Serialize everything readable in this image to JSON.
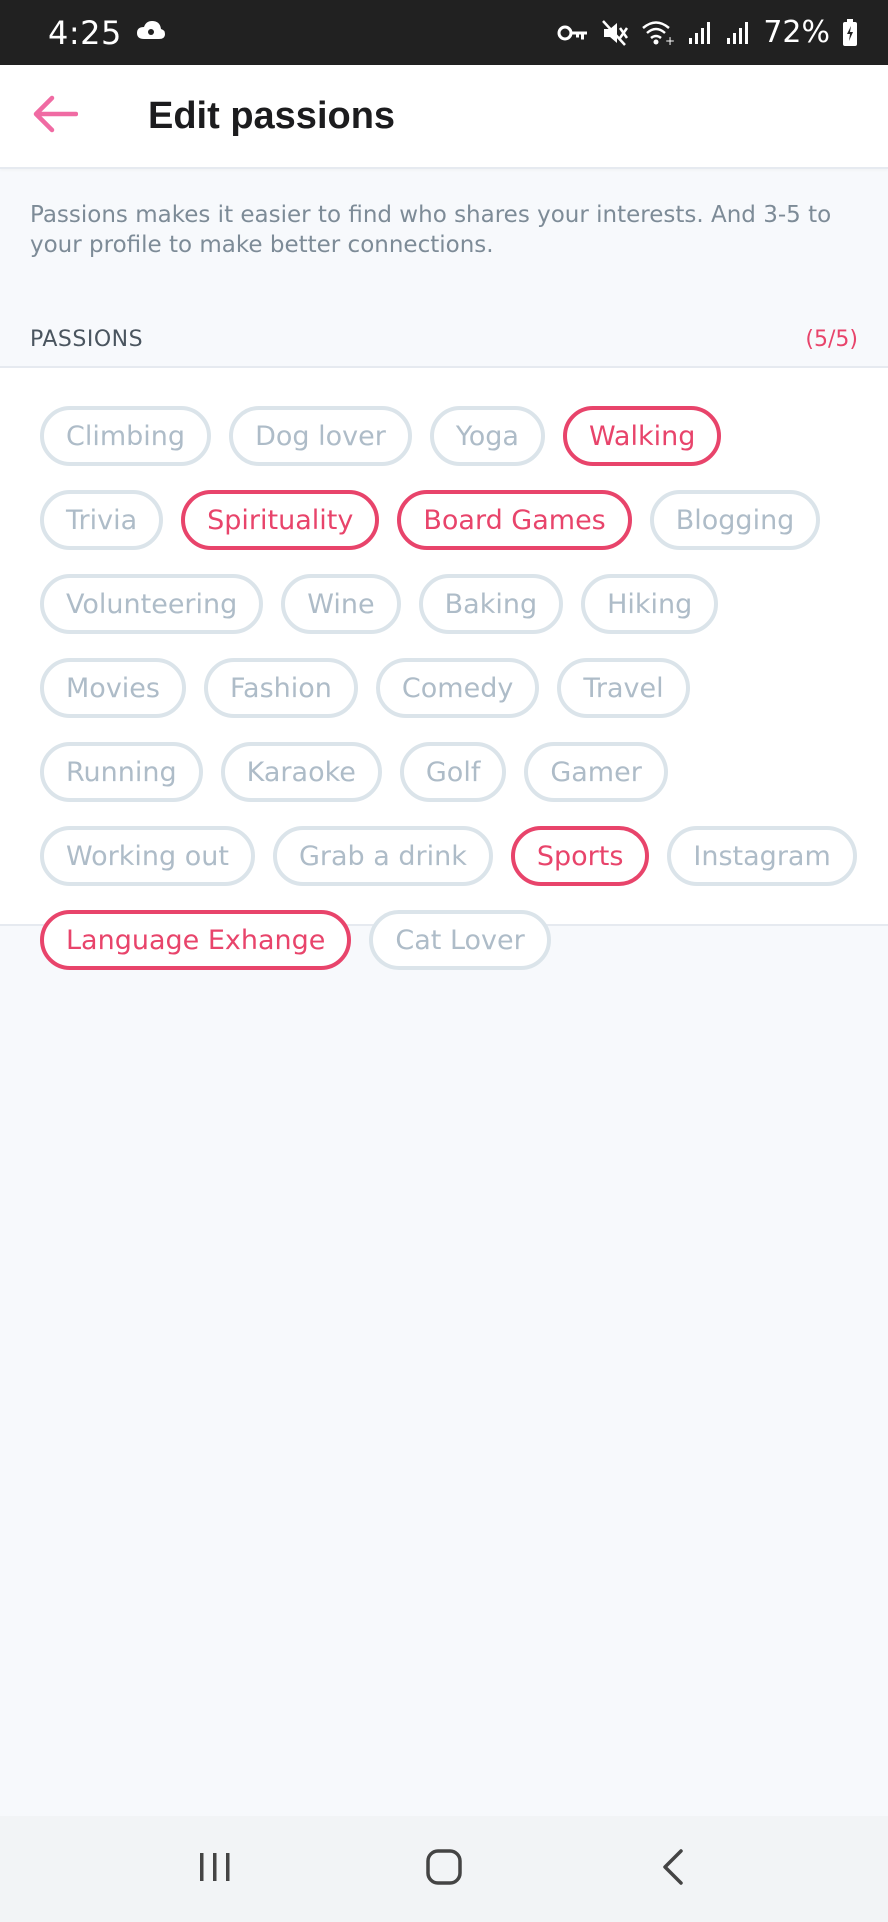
{
  "status_bar": {
    "time": "4:25",
    "battery": "72%"
  },
  "app_bar": {
    "title": "Edit passions",
    "back_icon": "arrow-left-icon",
    "accent_color": "#e8446b"
  },
  "description": "Passions makes it easier to find who shares your interests. And 3-5 to your profile to make better connections.",
  "section": {
    "label": "PASSIONS",
    "count": "(5/5)"
  },
  "passions": [
    {
      "label": "Climbing",
      "selected": false
    },
    {
      "label": "Dog lover",
      "selected": false
    },
    {
      "label": "Yoga",
      "selected": false
    },
    {
      "label": "Walking",
      "selected": true
    },
    {
      "label": "Trivia",
      "selected": false
    },
    {
      "label": "Spirituality",
      "selected": true
    },
    {
      "label": "Board Games",
      "selected": true
    },
    {
      "label": "Blogging",
      "selected": false
    },
    {
      "label": "Volunteering",
      "selected": false
    },
    {
      "label": "Wine",
      "selected": false
    },
    {
      "label": "Baking",
      "selected": false
    },
    {
      "label": "Hiking",
      "selected": false
    },
    {
      "label": "Movies",
      "selected": false
    },
    {
      "label": "Fashion",
      "selected": false
    },
    {
      "label": "Comedy",
      "selected": false
    },
    {
      "label": "Travel",
      "selected": false
    },
    {
      "label": "Running",
      "selected": false
    },
    {
      "label": "Karaoke",
      "selected": false
    },
    {
      "label": "Golf",
      "selected": false
    },
    {
      "label": "Gamer",
      "selected": false
    },
    {
      "label": "Working out",
      "selected": false
    },
    {
      "label": "Grab a drink",
      "selected": false
    },
    {
      "label": "Sports",
      "selected": true
    },
    {
      "label": "Instagram",
      "selected": false
    },
    {
      "label": "Language Exhange",
      "selected": true
    },
    {
      "label": "Cat Lover",
      "selected": false
    }
  ],
  "nav_bar": {
    "recents_icon": "recent-apps-icon",
    "home_icon": "home-icon",
    "back_icon": "back-chevron-icon"
  }
}
